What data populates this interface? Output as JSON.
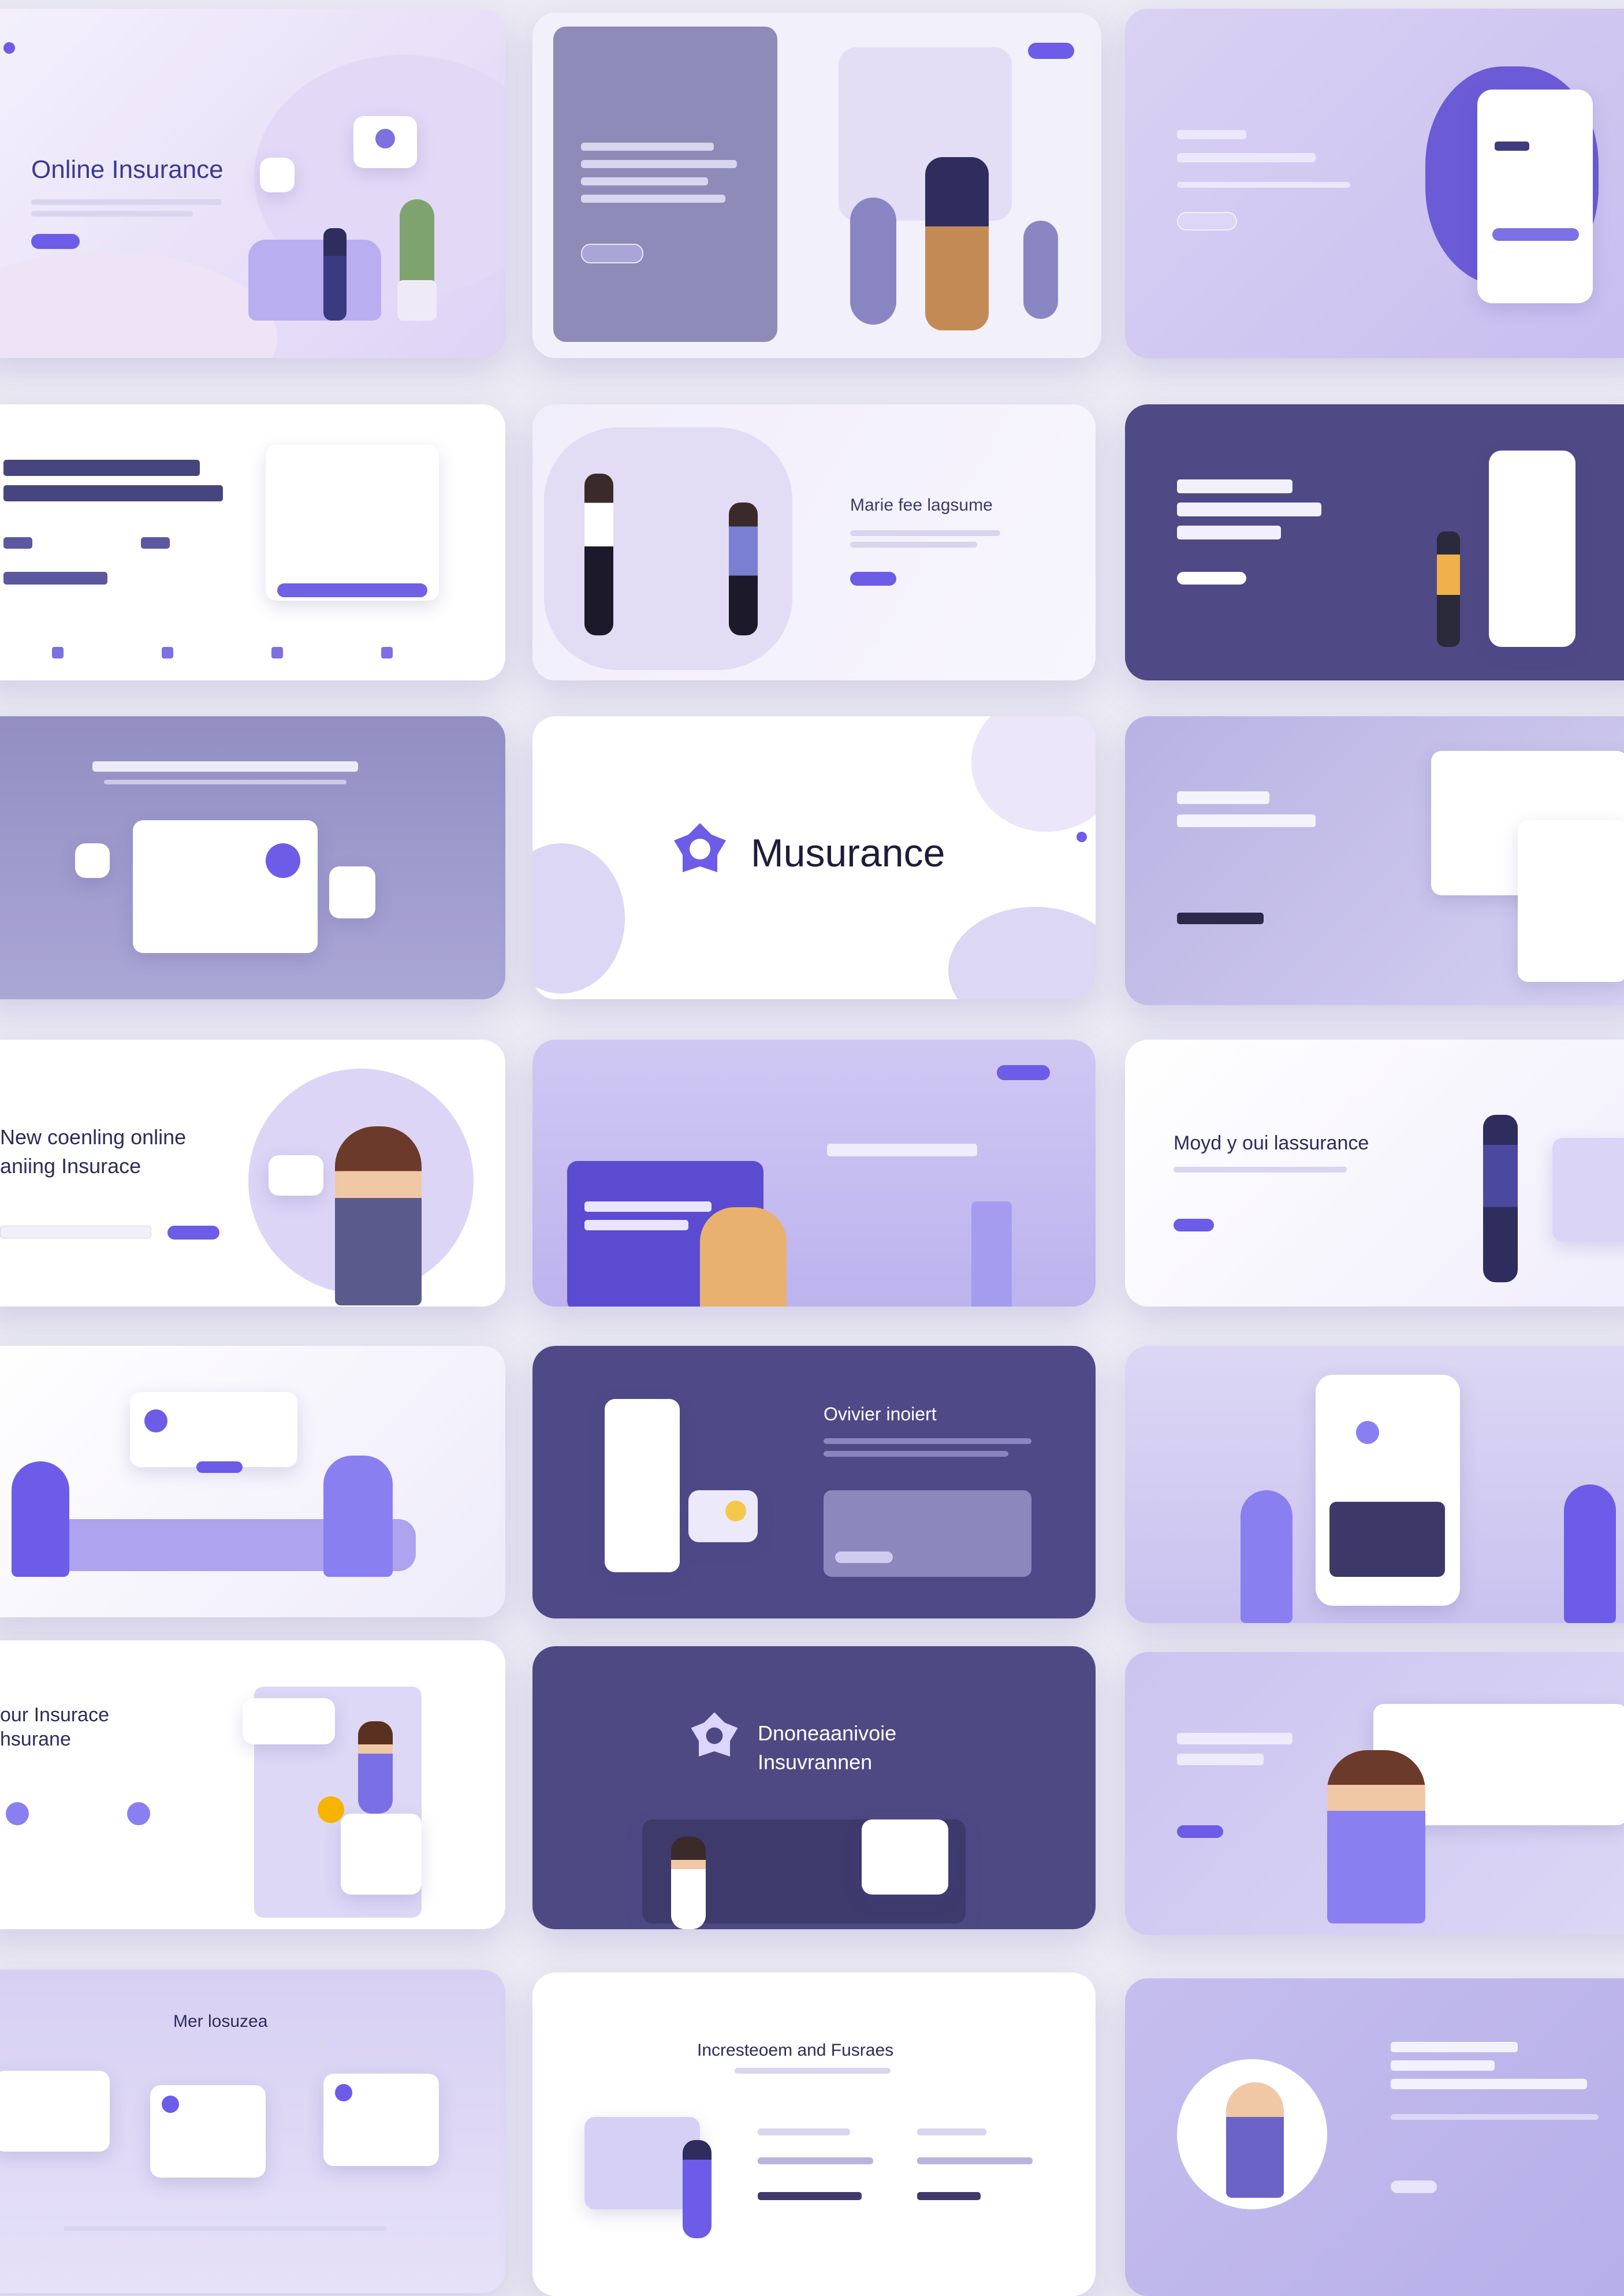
{
  "cards": {
    "c1": {
      "title": "Online Insurance"
    },
    "c5": {
      "title": "Marie fee lagsume"
    },
    "c8": {
      "brand": "Musurance"
    },
    "c10": {
      "title_line1": "New coenling online",
      "title_line2": "aniing Insurace"
    },
    "c12": {
      "title": "Moyd y oui lassurance"
    },
    "c14": {
      "title": "Ovivier inoiert"
    },
    "c16": {
      "title_line1": "our Insurace",
      "title_line2": "hsurane"
    },
    "c17": {
      "title_line1": "Dnoneaanivoie",
      "title_line2": "Insuvrannen"
    },
    "c19": {
      "title": "Mer losuzea"
    },
    "c20": {
      "title": "Incresteoem and Fusraes"
    }
  },
  "colors": {
    "accent": "#6c5ce7",
    "dark": "#4d4780",
    "slate": "#8f8bb8",
    "lavender": "#cfcaf2"
  }
}
